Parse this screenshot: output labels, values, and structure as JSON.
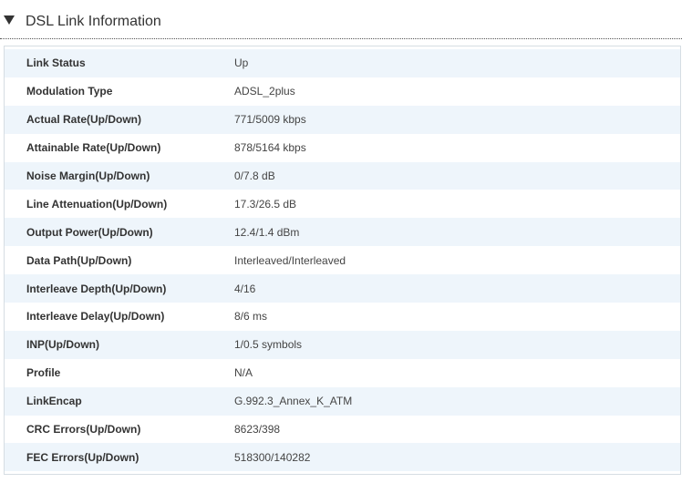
{
  "section": {
    "title": "DSL Link Information",
    "toggle_icon": "triangle-down-icon"
  },
  "rows": [
    {
      "label": "Link Status",
      "value": "Up"
    },
    {
      "label": "Modulation Type",
      "value": "ADSL_2plus"
    },
    {
      "label": "Actual Rate(Up/Down)",
      "value": "771/5009 kbps"
    },
    {
      "label": "Attainable Rate(Up/Down)",
      "value": "878/5164 kbps"
    },
    {
      "label": "Noise Margin(Up/Down)",
      "value": "0/7.8 dB"
    },
    {
      "label": "Line Attenuation(Up/Down)",
      "value": "17.3/26.5 dB"
    },
    {
      "label": "Output Power(Up/Down)",
      "value": "12.4/1.4 dBm"
    },
    {
      "label": "Data Path(Up/Down)",
      "value": "Interleaved/Interleaved"
    },
    {
      "label": "Interleave Depth(Up/Down)",
      "value": "4/16"
    },
    {
      "label": "Interleave Delay(Up/Down)",
      "value": "8/6 ms"
    },
    {
      "label": "INP(Up/Down)",
      "value": "1/0.5 symbols"
    },
    {
      "label": "Profile",
      "value": "N/A"
    },
    {
      "label": "LinkEncap",
      "value": "G.992.3_Annex_K_ATM"
    },
    {
      "label": "CRC Errors(Up/Down)",
      "value": "8623/398"
    },
    {
      "label": "FEC Errors(Up/Down)",
      "value": "518300/140282"
    }
  ],
  "colors": {
    "row_stripe": "#eef5fb",
    "panel_border": "#d6dde3",
    "text": "#333333"
  }
}
